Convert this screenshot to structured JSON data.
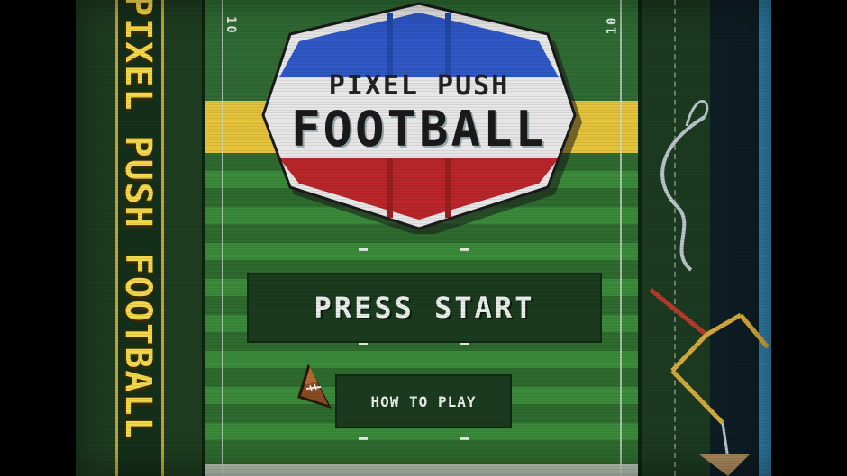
{
  "game": {
    "side_banner_text": "PIXEL PUSH FOOTBALL",
    "logo": {
      "line1": "PIXEL PUSH",
      "line2": "FOOTBALL"
    },
    "yard_markers": {
      "left": "10",
      "right": "10"
    },
    "menu": {
      "start_label": "PRESS START",
      "howto_label": "HOW TO PLAY",
      "selected": "HOW TO PLAY"
    },
    "icons": {
      "cursor": "football-cursor-icon",
      "goalpost": "goalpost-icon"
    },
    "colors": {
      "logo_top": "#2f58c6",
      "logo_bottom": "#b8262a",
      "banner_text": "#f2d84a",
      "field": "#2e6b2e",
      "accent_yellow": "#e4c33a"
    }
  }
}
